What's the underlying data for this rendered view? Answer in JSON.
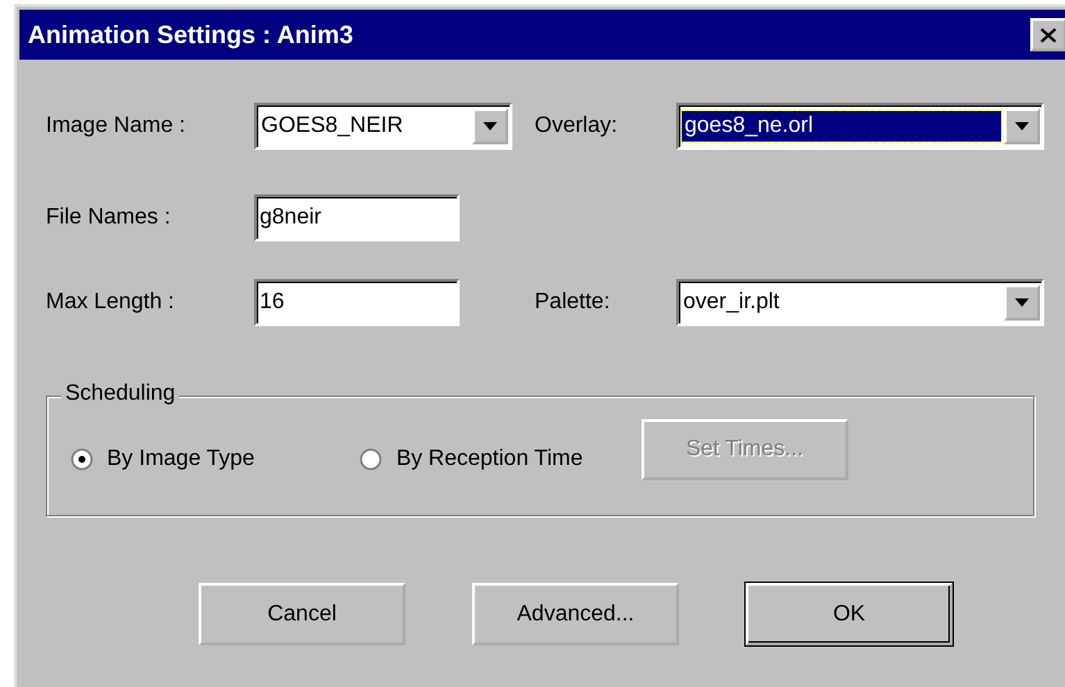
{
  "window": {
    "title": "Animation Settings : Anim3"
  },
  "rows": [
    [
      {
        "kind": "combo",
        "label": "Image Name :",
        "value": "GOES8_NEIR",
        "focused": false
      },
      {
        "kind": "combo",
        "label": "Overlay:",
        "value": "goes8_ne.orl",
        "focused": true
      }
    ],
    [
      {
        "kind": "text",
        "label": "File Names :",
        "value": "g8neir",
        "focused": false
      }
    ],
    [
      {
        "kind": "text",
        "label": "Max Length :",
        "value": "16",
        "focused": false
      },
      {
        "kind": "combo",
        "label": "Palette:",
        "value": "over_ir.plt",
        "focused": false
      }
    ]
  ],
  "scheduling": {
    "title": "Scheduling",
    "options": [
      {
        "label": "By Image Type",
        "selected": true
      },
      {
        "label": "By Reception Time",
        "selected": false
      }
    ],
    "set_times": {
      "label": "Set Times...",
      "disabled": true
    }
  },
  "buttons": [
    {
      "label": "Cancel",
      "default": false
    },
    {
      "label": "Advanced...",
      "default": false
    },
    {
      "label": "OK",
      "default": true
    }
  ]
}
